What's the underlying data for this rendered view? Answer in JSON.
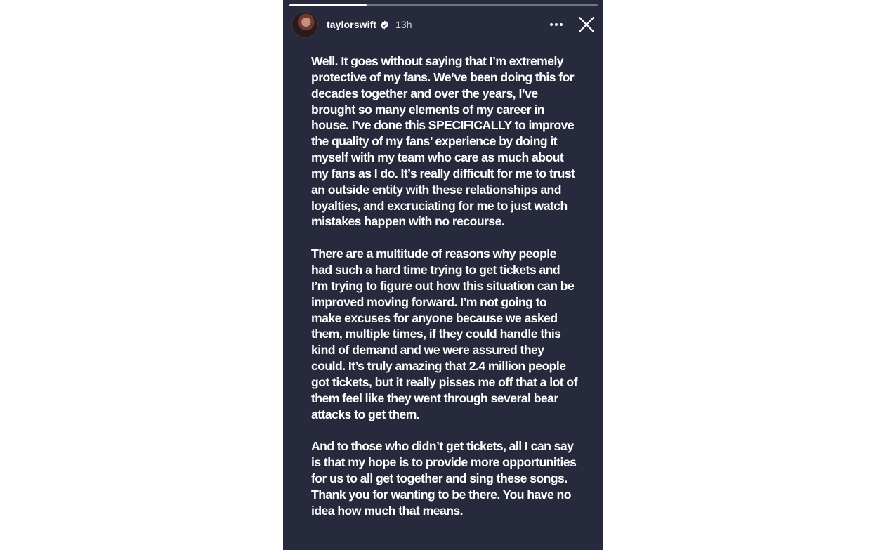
{
  "story": {
    "background": "#262a3c",
    "progress": 0.25,
    "user": {
      "username": "taylorswift",
      "verified": true,
      "time_ago": "13h"
    },
    "icons": {
      "avatar": "avatar-image",
      "verified": "verified-badge-icon",
      "more": "more-options-icon",
      "close": "close-icon"
    },
    "paragraphs": [
      "Well. It goes without saying that I’m extremely protective of my fans. We’ve been doing this for decades together and over the years, I’ve brought so many elements of my career in house. I’ve done this SPECIFICALLY to improve the quality of my fans’ experience by doing it myself with my team who care as much about my fans as I do. It’s really difficult for me to trust an outside entity with these relationships and loyalties, and excruciating for me to just watch mistakes happen with no recourse.",
      "There are a multitude of reasons why people had such a hard time trying to get tickets and I’m trying to figure out how this situation can be improved moving forward. I’m not going to make excuses for anyone because we asked them, multiple times, if they could handle this kind of demand and we were assured they could. It’s truly amazing that 2.4 million people got tickets, but it really pisses me off that a lot of them feel like they went through several bear attacks to get them.",
      "And to those who didn’t get tickets, all I can say is that my hope is to provide more opportunities for us to all get together and sing these songs. Thank you for wanting to be there. You have no idea how much that means."
    ]
  }
}
